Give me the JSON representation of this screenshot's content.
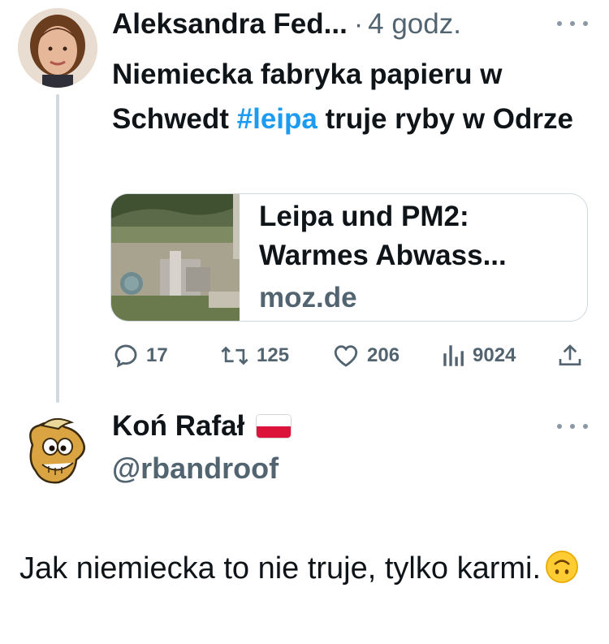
{
  "tweet": {
    "author_name": "Aleksandra Fed...",
    "separator": "·",
    "time": "4 godz.",
    "text_before": "Niemiecka fabryka papieru w Schwedt ",
    "hashtag": "#leipa",
    "text_after": "  truje ryby w Odrze",
    "link_card": {
      "title": "Leipa und PM2: Warmes Abwass...",
      "domain": "moz.de"
    },
    "actions": {
      "replies": "17",
      "retweets": "125",
      "likes": "206",
      "views": "9024"
    }
  },
  "reply": {
    "author_name": "Koń Rafał",
    "handle": "@rbandroof",
    "text": "Jak niemiecka to nie truje, tylko karmi.",
    "flag_icon": "poland-flag-icon",
    "emoji_icon": "upside-down-face-icon"
  },
  "colors": {
    "text": "#0f1419",
    "muted": "#536471",
    "link": "#1d9bf0",
    "border": "#cfd9de"
  }
}
